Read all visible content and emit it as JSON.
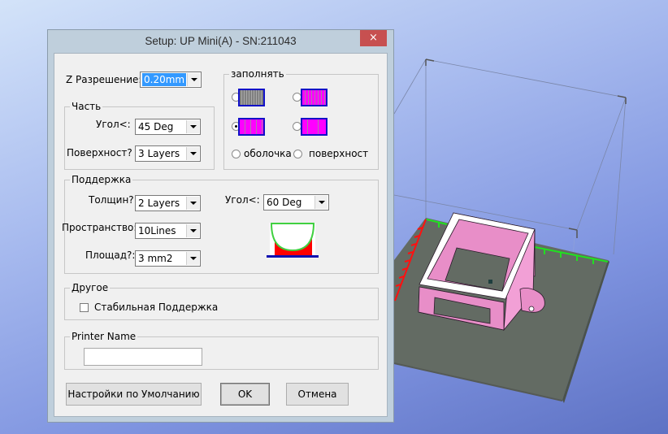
{
  "dialog": {
    "title": "Setup: UP Mini(A) - SN:211043",
    "close_label": "×",
    "z_resolution": {
      "label": "Z Разрешение:",
      "value": "0.20mm"
    },
    "part": {
      "group_label": "Часть",
      "angle": {
        "label": "Угол<:",
        "value": "45 Deg"
      },
      "surface": {
        "label": "Поверхност?",
        "value": "3 Layers"
      }
    },
    "fill": {
      "group_label": "заполнять",
      "options": [
        {
          "name": "fill-dense-gray",
          "selected": false
        },
        {
          "name": "fill-dense-magenta",
          "selected": false
        },
        {
          "name": "fill-medium-magenta",
          "selected": true
        },
        {
          "name": "fill-sparse-magenta",
          "selected": false
        }
      ],
      "shell_label": "оболочка",
      "surface_label": "поверхност",
      "colors": {
        "border": "#1010c8",
        "magenta": "#ff00ff",
        "gray": "#808080",
        "stripe": "#a0a0a0"
      }
    },
    "support": {
      "group_label": "Поддержка",
      "thickness": {
        "label": "Толщин?",
        "value": "2 Layers"
      },
      "space": {
        "label": "Пространство:",
        "value": "10Lines"
      },
      "area": {
        "label": "Площад?:",
        "value": "3 mm2"
      },
      "angle": {
        "label": "Угол<:",
        "value": "60 Deg"
      }
    },
    "other": {
      "group_label": "Другое",
      "stable_support_label": "Стабильная Поддержка",
      "stable_support_checked": false
    },
    "printer_name": {
      "group_label": "Printer Name",
      "value": ""
    },
    "buttons": {
      "defaults": "Настройки по Умолчанию",
      "ok": "OK",
      "cancel": "Отмена"
    }
  },
  "viewport": {
    "colors": {
      "platform": "#636b63",
      "model": "#e88ec8",
      "x_axis": "#ff1010",
      "y_axis": "#20e020"
    }
  }
}
